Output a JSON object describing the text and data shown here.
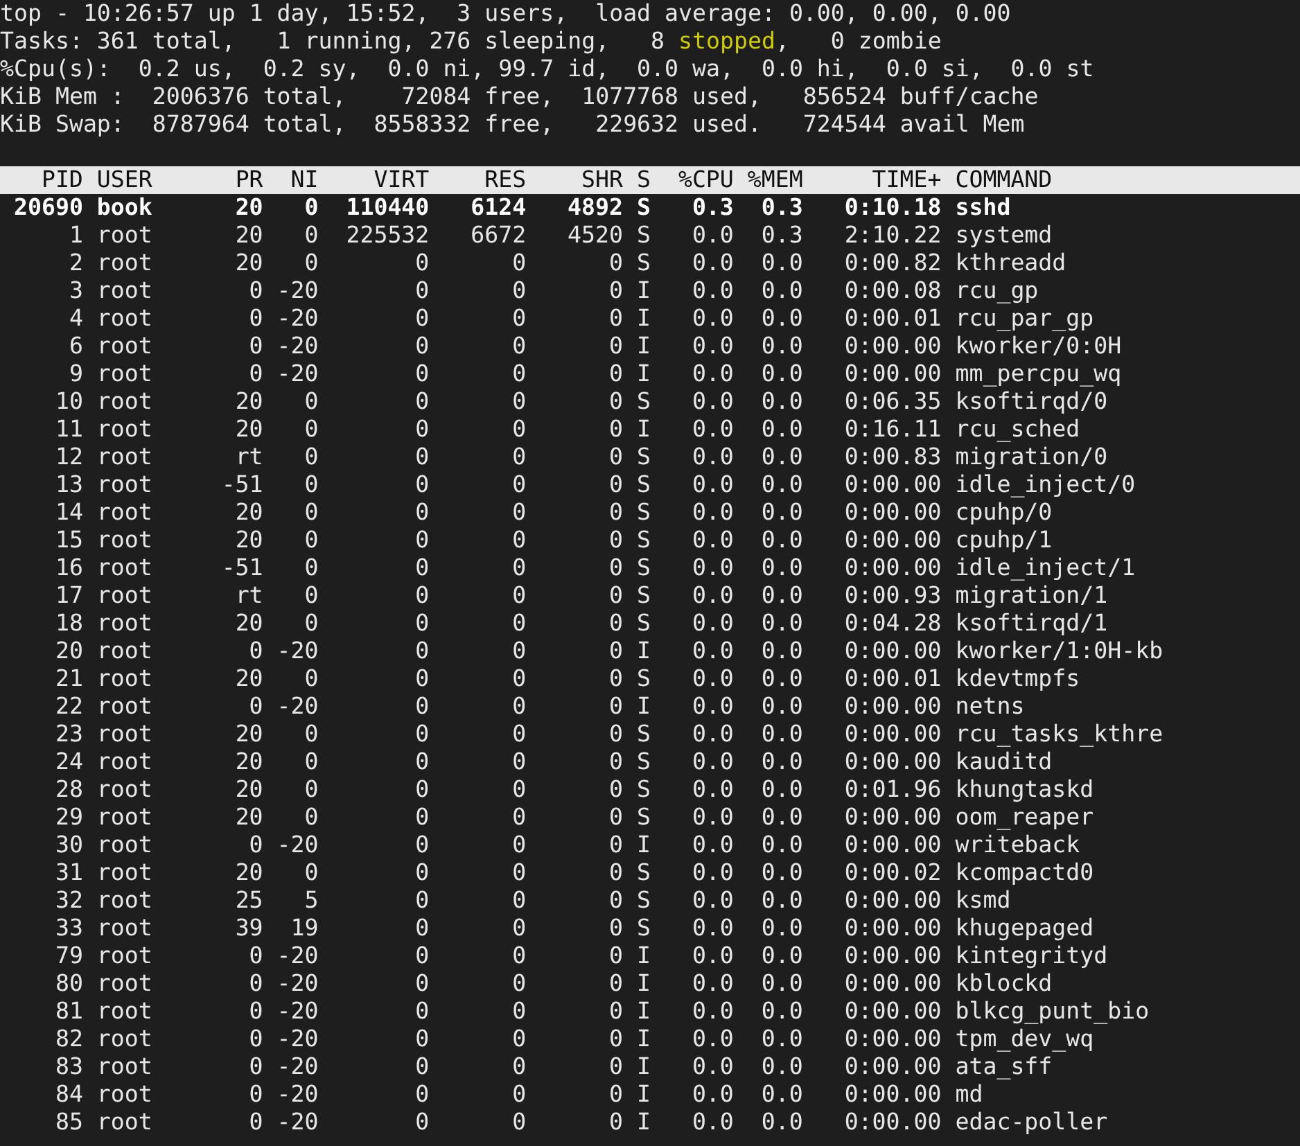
{
  "summary_lines": [
    {
      "segments": [
        {
          "text": "top - 10:26:57 up 1 day, 15:52,  3 users,  load average: 0.00, 0.00, 0.00",
          "highlighted": false
        }
      ]
    },
    {
      "segments": [
        {
          "text": "Tasks: 361 total,   1 running, 276 sleeping,   8 ",
          "highlighted": false
        },
        {
          "text": "stopped",
          "highlighted": true
        },
        {
          "text": ",   0 zombie",
          "highlighted": false
        }
      ]
    },
    {
      "segments": [
        {
          "text": "%Cpu(s):  0.2 us,  0.2 sy,  0.0 ni, 99.7 id,  0.0 wa,  0.0 hi,  0.0 si,  0.0 st",
          "highlighted": false
        }
      ]
    },
    {
      "segments": [
        {
          "text": "KiB Mem :  2006376 total,    72084 free,  1077768 used,   856524 buff/cache",
          "highlighted": false
        }
      ]
    },
    {
      "segments": [
        {
          "text": "KiB Swap:  8787964 total,  8558332 free,   229632 used.   724544 avail Mem",
          "highlighted": false
        }
      ]
    }
  ],
  "table": {
    "columns": [
      "PID",
      "USER",
      "PR",
      "NI",
      "VIRT",
      "RES",
      "SHR",
      "S",
      "%CPU",
      "%MEM",
      "TIME+",
      "COMMAND"
    ],
    "rows": [
      {
        "cells": [
          "20690",
          "book",
          "20",
          "0",
          "110440",
          "6124",
          "4892",
          "S",
          "0.3",
          "0.3",
          "0:10.18",
          "sshd"
        ],
        "highlighted": true
      },
      {
        "cells": [
          "1",
          "root",
          "20",
          "0",
          "225532",
          "6672",
          "4520",
          "S",
          "0.0",
          "0.3",
          "2:10.22",
          "systemd"
        ],
        "highlighted": false
      },
      {
        "cells": [
          "2",
          "root",
          "20",
          "0",
          "0",
          "0",
          "0",
          "S",
          "0.0",
          "0.0",
          "0:00.82",
          "kthreadd"
        ],
        "highlighted": false
      },
      {
        "cells": [
          "3",
          "root",
          "0",
          "-20",
          "0",
          "0",
          "0",
          "I",
          "0.0",
          "0.0",
          "0:00.08",
          "rcu_gp"
        ],
        "highlighted": false
      },
      {
        "cells": [
          "4",
          "root",
          "0",
          "-20",
          "0",
          "0",
          "0",
          "I",
          "0.0",
          "0.0",
          "0:00.01",
          "rcu_par_gp"
        ],
        "highlighted": false
      },
      {
        "cells": [
          "6",
          "root",
          "0",
          "-20",
          "0",
          "0",
          "0",
          "I",
          "0.0",
          "0.0",
          "0:00.00",
          "kworker/0:0H"
        ],
        "highlighted": false
      },
      {
        "cells": [
          "9",
          "root",
          "0",
          "-20",
          "0",
          "0",
          "0",
          "I",
          "0.0",
          "0.0",
          "0:00.00",
          "mm_percpu_wq"
        ],
        "highlighted": false
      },
      {
        "cells": [
          "10",
          "root",
          "20",
          "0",
          "0",
          "0",
          "0",
          "S",
          "0.0",
          "0.0",
          "0:06.35",
          "ksoftirqd/0"
        ],
        "highlighted": false
      },
      {
        "cells": [
          "11",
          "root",
          "20",
          "0",
          "0",
          "0",
          "0",
          "I",
          "0.0",
          "0.0",
          "0:16.11",
          "rcu_sched"
        ],
        "highlighted": false
      },
      {
        "cells": [
          "12",
          "root",
          "rt",
          "0",
          "0",
          "0",
          "0",
          "S",
          "0.0",
          "0.0",
          "0:00.83",
          "migration/0"
        ],
        "highlighted": false
      },
      {
        "cells": [
          "13",
          "root",
          "-51",
          "0",
          "0",
          "0",
          "0",
          "S",
          "0.0",
          "0.0",
          "0:00.00",
          "idle_inject/0"
        ],
        "highlighted": false
      },
      {
        "cells": [
          "14",
          "root",
          "20",
          "0",
          "0",
          "0",
          "0",
          "S",
          "0.0",
          "0.0",
          "0:00.00",
          "cpuhp/0"
        ],
        "highlighted": false
      },
      {
        "cells": [
          "15",
          "root",
          "20",
          "0",
          "0",
          "0",
          "0",
          "S",
          "0.0",
          "0.0",
          "0:00.00",
          "cpuhp/1"
        ],
        "highlighted": false
      },
      {
        "cells": [
          "16",
          "root",
          "-51",
          "0",
          "0",
          "0",
          "0",
          "S",
          "0.0",
          "0.0",
          "0:00.00",
          "idle_inject/1"
        ],
        "highlighted": false
      },
      {
        "cells": [
          "17",
          "root",
          "rt",
          "0",
          "0",
          "0",
          "0",
          "S",
          "0.0",
          "0.0",
          "0:00.93",
          "migration/1"
        ],
        "highlighted": false
      },
      {
        "cells": [
          "18",
          "root",
          "20",
          "0",
          "0",
          "0",
          "0",
          "S",
          "0.0",
          "0.0",
          "0:04.28",
          "ksoftirqd/1"
        ],
        "highlighted": false
      },
      {
        "cells": [
          "20",
          "root",
          "0",
          "-20",
          "0",
          "0",
          "0",
          "I",
          "0.0",
          "0.0",
          "0:00.00",
          "kworker/1:0H-kb"
        ],
        "highlighted": false
      },
      {
        "cells": [
          "21",
          "root",
          "20",
          "0",
          "0",
          "0",
          "0",
          "S",
          "0.0",
          "0.0",
          "0:00.01",
          "kdevtmpfs"
        ],
        "highlighted": false
      },
      {
        "cells": [
          "22",
          "root",
          "0",
          "-20",
          "0",
          "0",
          "0",
          "I",
          "0.0",
          "0.0",
          "0:00.00",
          "netns"
        ],
        "highlighted": false
      },
      {
        "cells": [
          "23",
          "root",
          "20",
          "0",
          "0",
          "0",
          "0",
          "S",
          "0.0",
          "0.0",
          "0:00.00",
          "rcu_tasks_kthre"
        ],
        "highlighted": false
      },
      {
        "cells": [
          "24",
          "root",
          "20",
          "0",
          "0",
          "0",
          "0",
          "S",
          "0.0",
          "0.0",
          "0:00.00",
          "kauditd"
        ],
        "highlighted": false
      },
      {
        "cells": [
          "28",
          "root",
          "20",
          "0",
          "0",
          "0",
          "0",
          "S",
          "0.0",
          "0.0",
          "0:01.96",
          "khungtaskd"
        ],
        "highlighted": false
      },
      {
        "cells": [
          "29",
          "root",
          "20",
          "0",
          "0",
          "0",
          "0",
          "S",
          "0.0",
          "0.0",
          "0:00.00",
          "oom_reaper"
        ],
        "highlighted": false
      },
      {
        "cells": [
          "30",
          "root",
          "0",
          "-20",
          "0",
          "0",
          "0",
          "I",
          "0.0",
          "0.0",
          "0:00.00",
          "writeback"
        ],
        "highlighted": false
      },
      {
        "cells": [
          "31",
          "root",
          "20",
          "0",
          "0",
          "0",
          "0",
          "S",
          "0.0",
          "0.0",
          "0:00.02",
          "kcompactd0"
        ],
        "highlighted": false
      },
      {
        "cells": [
          "32",
          "root",
          "25",
          "5",
          "0",
          "0",
          "0",
          "S",
          "0.0",
          "0.0",
          "0:00.00",
          "ksmd"
        ],
        "highlighted": false
      },
      {
        "cells": [
          "33",
          "root",
          "39",
          "19",
          "0",
          "0",
          "0",
          "S",
          "0.0",
          "0.0",
          "0:00.00",
          "khugepaged"
        ],
        "highlighted": false
      },
      {
        "cells": [
          "79",
          "root",
          "0",
          "-20",
          "0",
          "0",
          "0",
          "I",
          "0.0",
          "0.0",
          "0:00.00",
          "kintegrityd"
        ],
        "highlighted": false
      },
      {
        "cells": [
          "80",
          "root",
          "0",
          "-20",
          "0",
          "0",
          "0",
          "I",
          "0.0",
          "0.0",
          "0:00.00",
          "kblockd"
        ],
        "highlighted": false
      },
      {
        "cells": [
          "81",
          "root",
          "0",
          "-20",
          "0",
          "0",
          "0",
          "I",
          "0.0",
          "0.0",
          "0:00.00",
          "blkcg_punt_bio"
        ],
        "highlighted": false
      },
      {
        "cells": [
          "82",
          "root",
          "0",
          "-20",
          "0",
          "0",
          "0",
          "I",
          "0.0",
          "0.0",
          "0:00.00",
          "tpm_dev_wq"
        ],
        "highlighted": false
      },
      {
        "cells": [
          "83",
          "root",
          "0",
          "-20",
          "0",
          "0",
          "0",
          "I",
          "0.0",
          "0.0",
          "0:00.00",
          "ata_sff"
        ],
        "highlighted": false
      },
      {
        "cells": [
          "84",
          "root",
          "0",
          "-20",
          "0",
          "0",
          "0",
          "I",
          "0.0",
          "0.0",
          "0:00.00",
          "md"
        ],
        "highlighted": false
      },
      {
        "cells": [
          "85",
          "root",
          "0",
          "-20",
          "0",
          "0",
          "0",
          "I",
          "0.0",
          "0.0",
          "0:00.00",
          "edac-poller"
        ],
        "highlighted": false
      }
    ]
  }
}
